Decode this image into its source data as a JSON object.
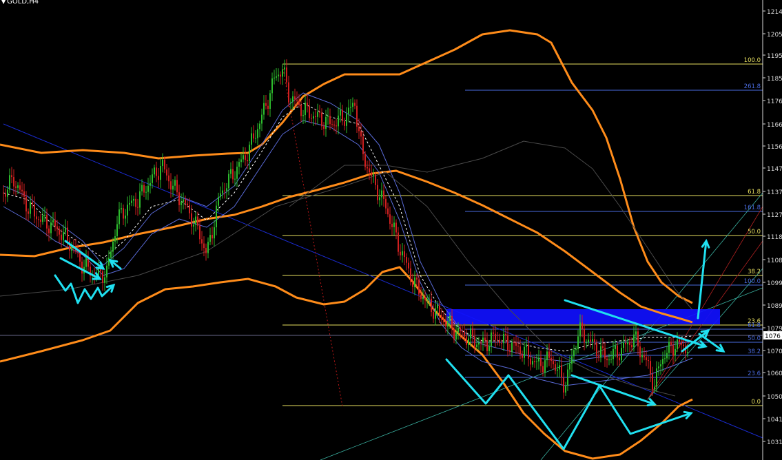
{
  "window": {
    "title": "GOLD,H4"
  },
  "colors": {
    "background": "#000000",
    "bull_candle": "#2dbb2d",
    "bear_candle": "#d02020",
    "bollinger_orange": "#ff8c1a",
    "ma_blue": "#5a6bd8",
    "fib_yellow": "#e8e060",
    "fib_blue": "#4a6be0",
    "annotation_cyan": "#20e0f0",
    "zone_blue": "#1010ff",
    "trend_blue": "#1a2bd0",
    "price_axis": "#d8d8d8"
  },
  "price_axis": {
    "ticks": [
      "1214",
      "1205",
      "1195",
      "1185",
      "1176",
      "1166",
      "1156",
      "1147",
      "1137",
      "1127",
      "1118",
      "1108",
      "1099",
      "1089",
      "1079",
      "1070",
      "1060",
      "1050",
      "1041",
      "1031"
    ],
    "current_price": "1076"
  },
  "fib_retracement_main": {
    "levels": [
      "100.0",
      "61.8",
      "50.0",
      "38.2",
      "23.6",
      "0.0"
    ]
  },
  "fib_retracement_second": {
    "levels": [
      "261.8",
      "161.8",
      "100.0",
      "61.8",
      "50.0",
      "38.2",
      "23.6"
    ]
  }
}
